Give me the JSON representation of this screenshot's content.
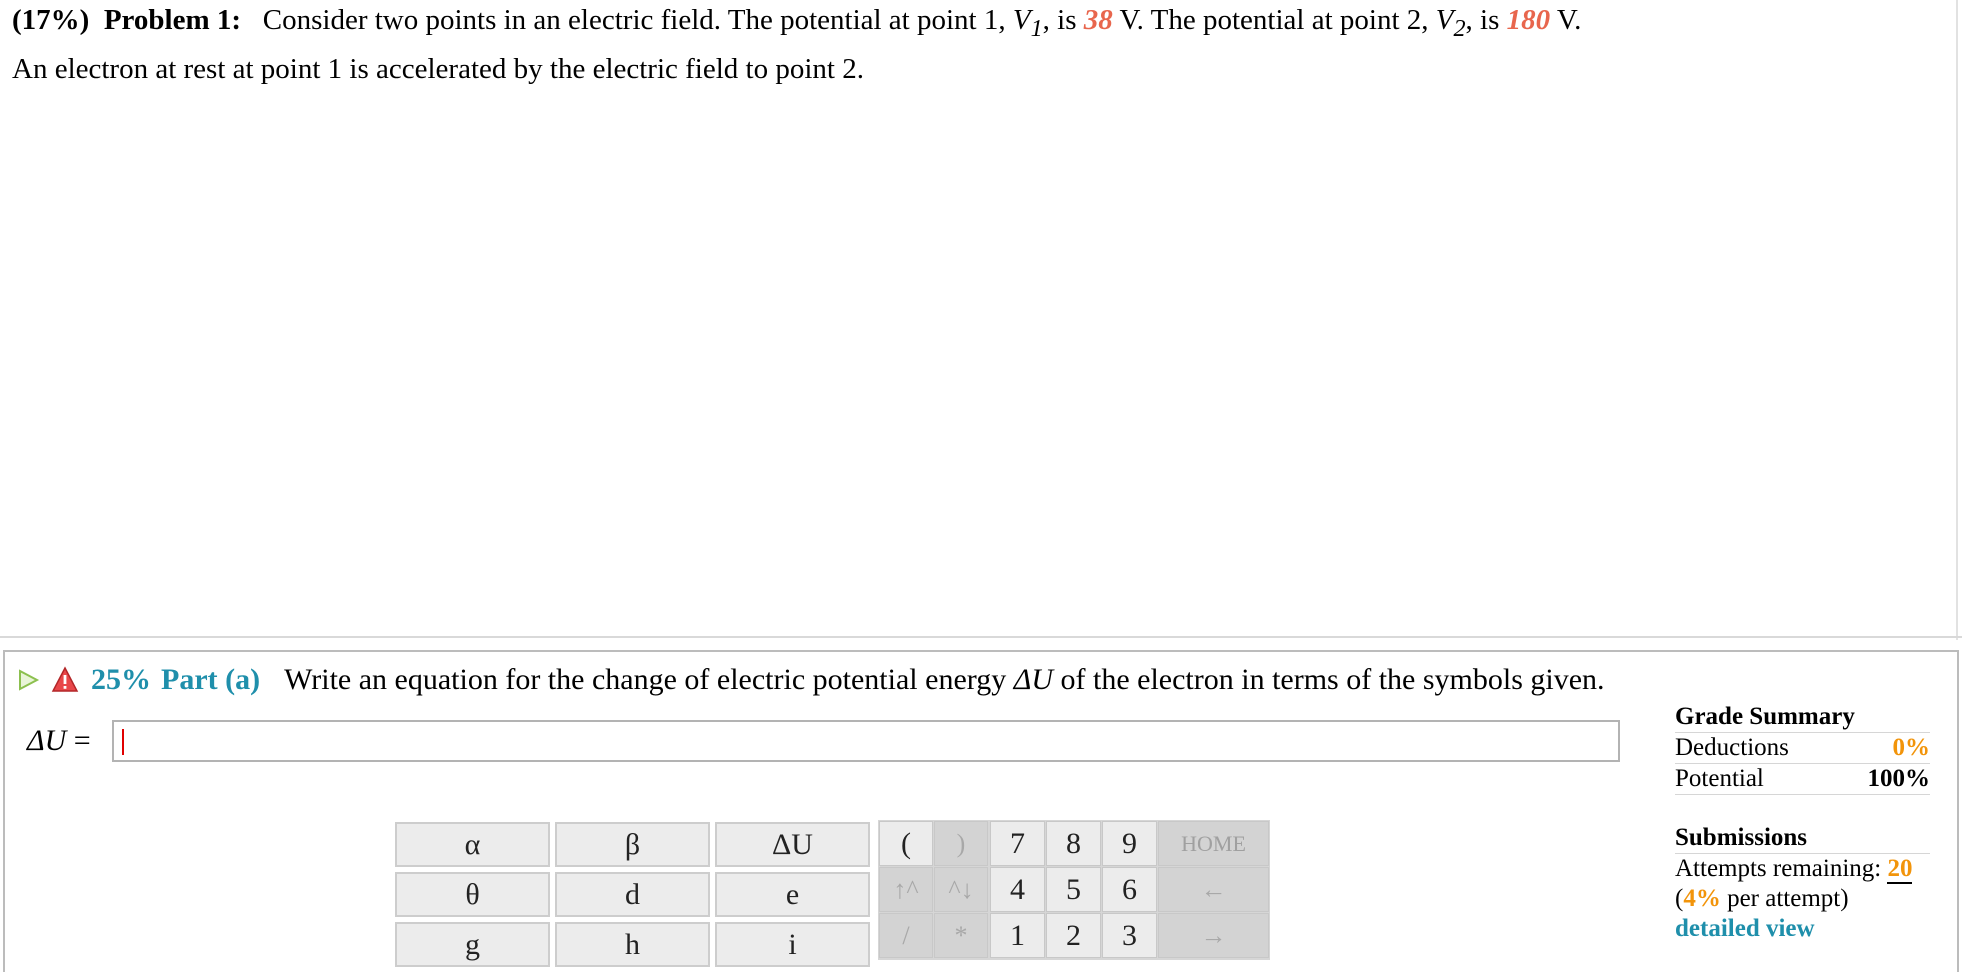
{
  "problem": {
    "weight": "(17%)",
    "label": "Problem 1:",
    "text_a": "Consider two points in an electric field. The potential at point 1,",
    "v1_symbol": "V",
    "v1_sub": "1",
    "text_b": ", is",
    "v1_value": "38",
    "text_c": "V. The potential at point 2,",
    "v2_symbol": "V",
    "v2_sub": "2",
    "text_d": ", is",
    "v2_value": "180",
    "text_e": "V.",
    "line2": "An electron at rest at point 1 is accelerated by the electric field to point 2."
  },
  "part": {
    "percent": "25%",
    "name": "Part (a)",
    "prompt_a": "Write an equation for the change of electric potential energy",
    "prompt_symbol": "ΔU",
    "prompt_b": "of the electron in terms of the symbols given."
  },
  "answer": {
    "label_symbol": "ΔU",
    "label_eq": " =",
    "value": ""
  },
  "keypad": {
    "greek": [
      "α",
      "β",
      "ΔU",
      "θ",
      "d",
      "e",
      "g",
      "h",
      "i"
    ],
    "numbers": {
      "open": "(",
      "close": ")",
      "k7": "7",
      "k8": "8",
      "k9": "9",
      "home": "HOME",
      "up": "↑^",
      "down": "^↓",
      "k4": "4",
      "k5": "5",
      "k6": "6",
      "back": "←",
      "div": "/",
      "mul": "*",
      "k1": "1",
      "k2": "2",
      "k3": "3",
      "fwd": "→"
    }
  },
  "grade_summary": {
    "title": "Grade Summary",
    "deductions_label": "Deductions",
    "deductions_value": "0%",
    "potential_label": "Potential",
    "potential_value": "100%"
  },
  "submissions": {
    "title": "Submissions",
    "attempts_label": "Attempts remaining:",
    "attempts_value": "20",
    "per_open": "(",
    "per_value": "4%",
    "per_text": " per attempt)",
    "detailed_view": "detailed view"
  },
  "colors": {
    "accent": "#1f8fab",
    "highlight": "#e8664d",
    "orange": "#f2940a"
  }
}
